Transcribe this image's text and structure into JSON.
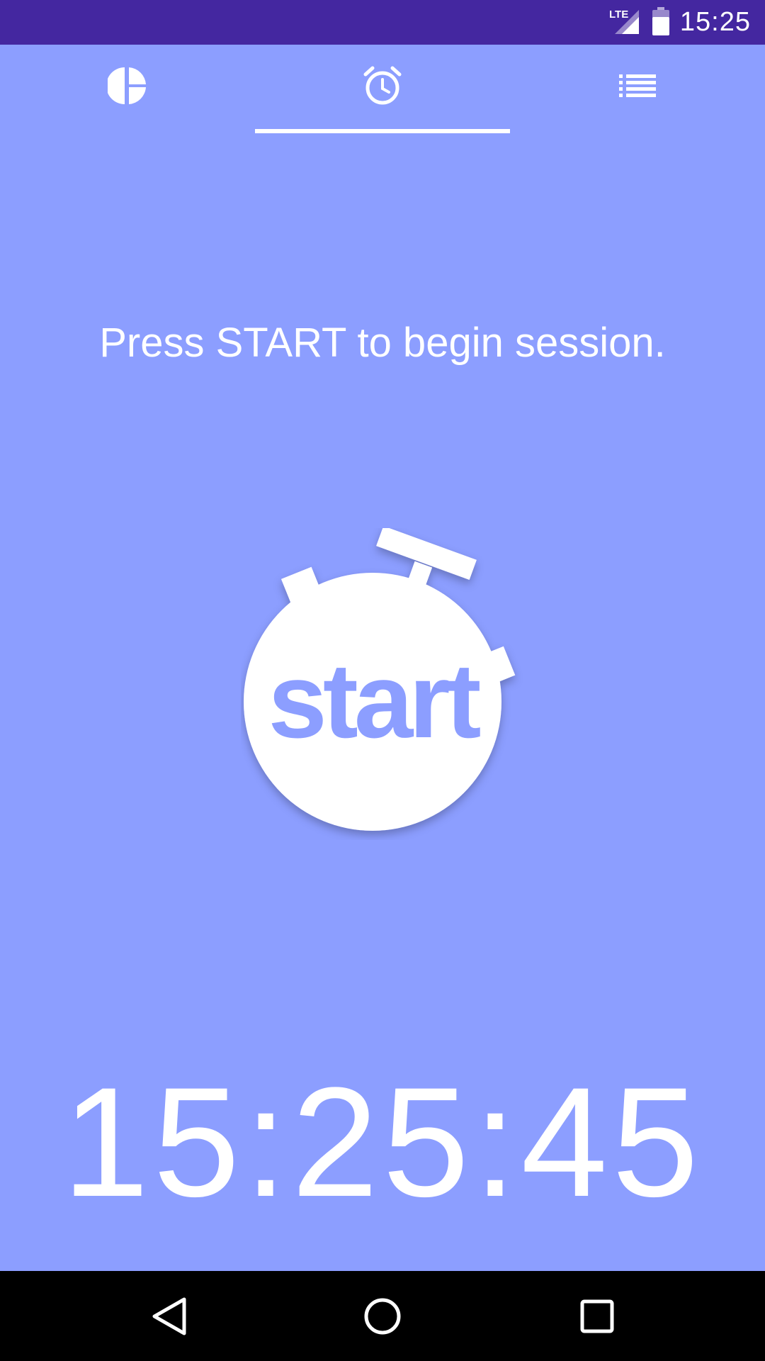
{
  "status_bar": {
    "time": "15:25",
    "network_label": "LTE",
    "icons": [
      "lte-signal-icon",
      "battery-icon"
    ],
    "background": "#4427a0"
  },
  "tabs": [
    {
      "name": "stats",
      "icon": "pie-chart-icon",
      "selected": false
    },
    {
      "name": "timer",
      "icon": "alarm-clock-icon",
      "selected": true
    },
    {
      "name": "list",
      "icon": "list-icon",
      "selected": false
    }
  ],
  "main": {
    "prompt": "Press START to begin session.",
    "start_button_label": "start",
    "clock": "15:25:45",
    "background": "#8c9eff",
    "accent": "#ffffff"
  },
  "nav_bar": {
    "buttons": [
      "back-icon",
      "home-icon",
      "recents-icon"
    ]
  }
}
